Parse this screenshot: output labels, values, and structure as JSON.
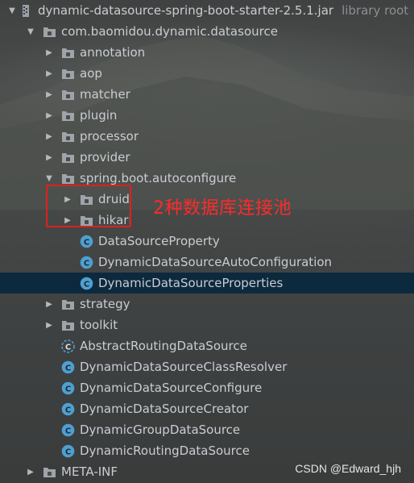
{
  "tree": [
    {
      "label": "dynamic-datasource-spring-boot-starter-2.5.1.jar",
      "extra": "library root",
      "icon": "jar-icon",
      "arrow": "down",
      "indent": 0
    },
    {
      "label": "com.baomidou.dynamic.datasource",
      "icon": "package-icon",
      "arrow": "down",
      "indent": 1
    },
    {
      "label": "annotation",
      "icon": "package-icon",
      "arrow": "right",
      "indent": 2
    },
    {
      "label": "aop",
      "icon": "package-icon",
      "arrow": "right",
      "indent": 2
    },
    {
      "label": "matcher",
      "icon": "package-icon",
      "arrow": "right",
      "indent": 2
    },
    {
      "label": "plugin",
      "icon": "package-icon",
      "arrow": "right",
      "indent": 2
    },
    {
      "label": "processor",
      "icon": "package-icon",
      "arrow": "right",
      "indent": 2
    },
    {
      "label": "provider",
      "icon": "package-icon",
      "arrow": "right",
      "indent": 2
    },
    {
      "label": "spring.boot.autoconfigure",
      "icon": "package-icon",
      "arrow": "down",
      "indent": 2
    },
    {
      "label": "druid",
      "icon": "package-icon",
      "arrow": "right",
      "indent": 3
    },
    {
      "label": "hikari",
      "icon": "package-icon",
      "arrow": "right",
      "indent": 3
    },
    {
      "label": "DataSourceProperty",
      "icon": "class-icon",
      "arrow": "none",
      "indent": 3
    },
    {
      "label": "DynamicDataSourceAutoConfiguration",
      "icon": "class-icon",
      "arrow": "none",
      "indent": 3
    },
    {
      "label": "DynamicDataSourceProperties",
      "icon": "class-icon",
      "arrow": "none",
      "indent": 3,
      "selected": true
    },
    {
      "label": "strategy",
      "icon": "package-icon",
      "arrow": "right",
      "indent": 2
    },
    {
      "label": "toolkit",
      "icon": "package-icon",
      "arrow": "right",
      "indent": 2
    },
    {
      "label": "AbstractRoutingDataSource",
      "icon": "abstract-class-icon",
      "arrow": "none",
      "indent": 2
    },
    {
      "label": "DynamicDataSourceClassResolver",
      "icon": "class-icon",
      "arrow": "none",
      "indent": 2
    },
    {
      "label": "DynamicDataSourceConfigure",
      "icon": "class-icon",
      "arrow": "none",
      "indent": 2
    },
    {
      "label": "DynamicDataSourceCreator",
      "icon": "class-icon",
      "arrow": "none",
      "indent": 2
    },
    {
      "label": "DynamicGroupDataSource",
      "icon": "class-icon",
      "arrow": "none",
      "indent": 2
    },
    {
      "label": "DynamicRoutingDataSource",
      "icon": "class-icon",
      "arrow": "none",
      "indent": 2
    },
    {
      "label": "META-INF",
      "icon": "package-icon",
      "arrow": "right",
      "indent": 1
    }
  ],
  "annotation": {
    "text": "2种数据库连接池"
  },
  "watermark": "CSDN @Edward_hjh",
  "colors": {
    "selected_row": "#0d293e",
    "annotation": "#e02020",
    "class_icon": "#4f9fd0"
  }
}
